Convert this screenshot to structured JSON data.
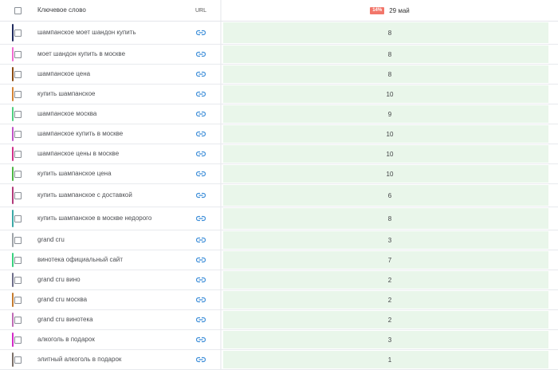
{
  "header": {
    "keyword_label": "Ключевое слово",
    "url_label": "URL",
    "change_badge": "14%",
    "date_label": "29 май"
  },
  "rows": [
    {
      "keyword": "шампанское моет шандон купить",
      "position": "8",
      "color": "#1f2a5e",
      "height": 28
    },
    {
      "keyword": "моет шандон купить в москве",
      "position": "8",
      "color": "#f06ad0",
      "height": 24
    },
    {
      "keyword": "шампанское цена",
      "position": "8",
      "color": "#8a4b12",
      "height": 24
    },
    {
      "keyword": "купить шампанское",
      "position": "10",
      "color": "#d38435",
      "height": 24
    },
    {
      "keyword": "шампанское москва",
      "position": "9",
      "color": "#4fcf7f",
      "height": 24
    },
    {
      "keyword": "шампанское купить в москве",
      "position": "10",
      "color": "#c052c6",
      "height": 24
    },
    {
      "keyword": "шампанское цены в москве",
      "position": "10",
      "color": "#d0308a",
      "height": 24
    },
    {
      "keyword": "купить шампанское цена",
      "position": "10",
      "color": "#4db545",
      "height": 24
    },
    {
      "keyword": "купить шампанское с доставкой",
      "position": "6",
      "color": "#b23a7a",
      "height": 28
    },
    {
      "keyword": "купить шампанское в москве недорого",
      "position": "8",
      "color": "#3ba8a6",
      "height": 28
    },
    {
      "keyword": "grand cru",
      "position": "3",
      "color": "#9ea3a8",
      "height": 24
    },
    {
      "keyword": "винотека официальный сайт",
      "position": "7",
      "color": "#38d27e",
      "height": 24
    },
    {
      "keyword": "grand cru вино",
      "position": "2",
      "color": "#6e6e8a",
      "height": 24
    },
    {
      "keyword": "grand cru москва",
      "position": "2",
      "color": "#c57b2e",
      "height": 24
    },
    {
      "keyword": "grand cru винотека",
      "position": "2",
      "color": "#c06ab5",
      "height": 24
    },
    {
      "keyword": "алкоголь в подарок",
      "position": "3",
      "color": "#d428c8",
      "height": 24
    },
    {
      "keyword": "элитный алкоголь в подарок",
      "position": "1",
      "color": "#7b7068",
      "height": 24
    }
  ]
}
